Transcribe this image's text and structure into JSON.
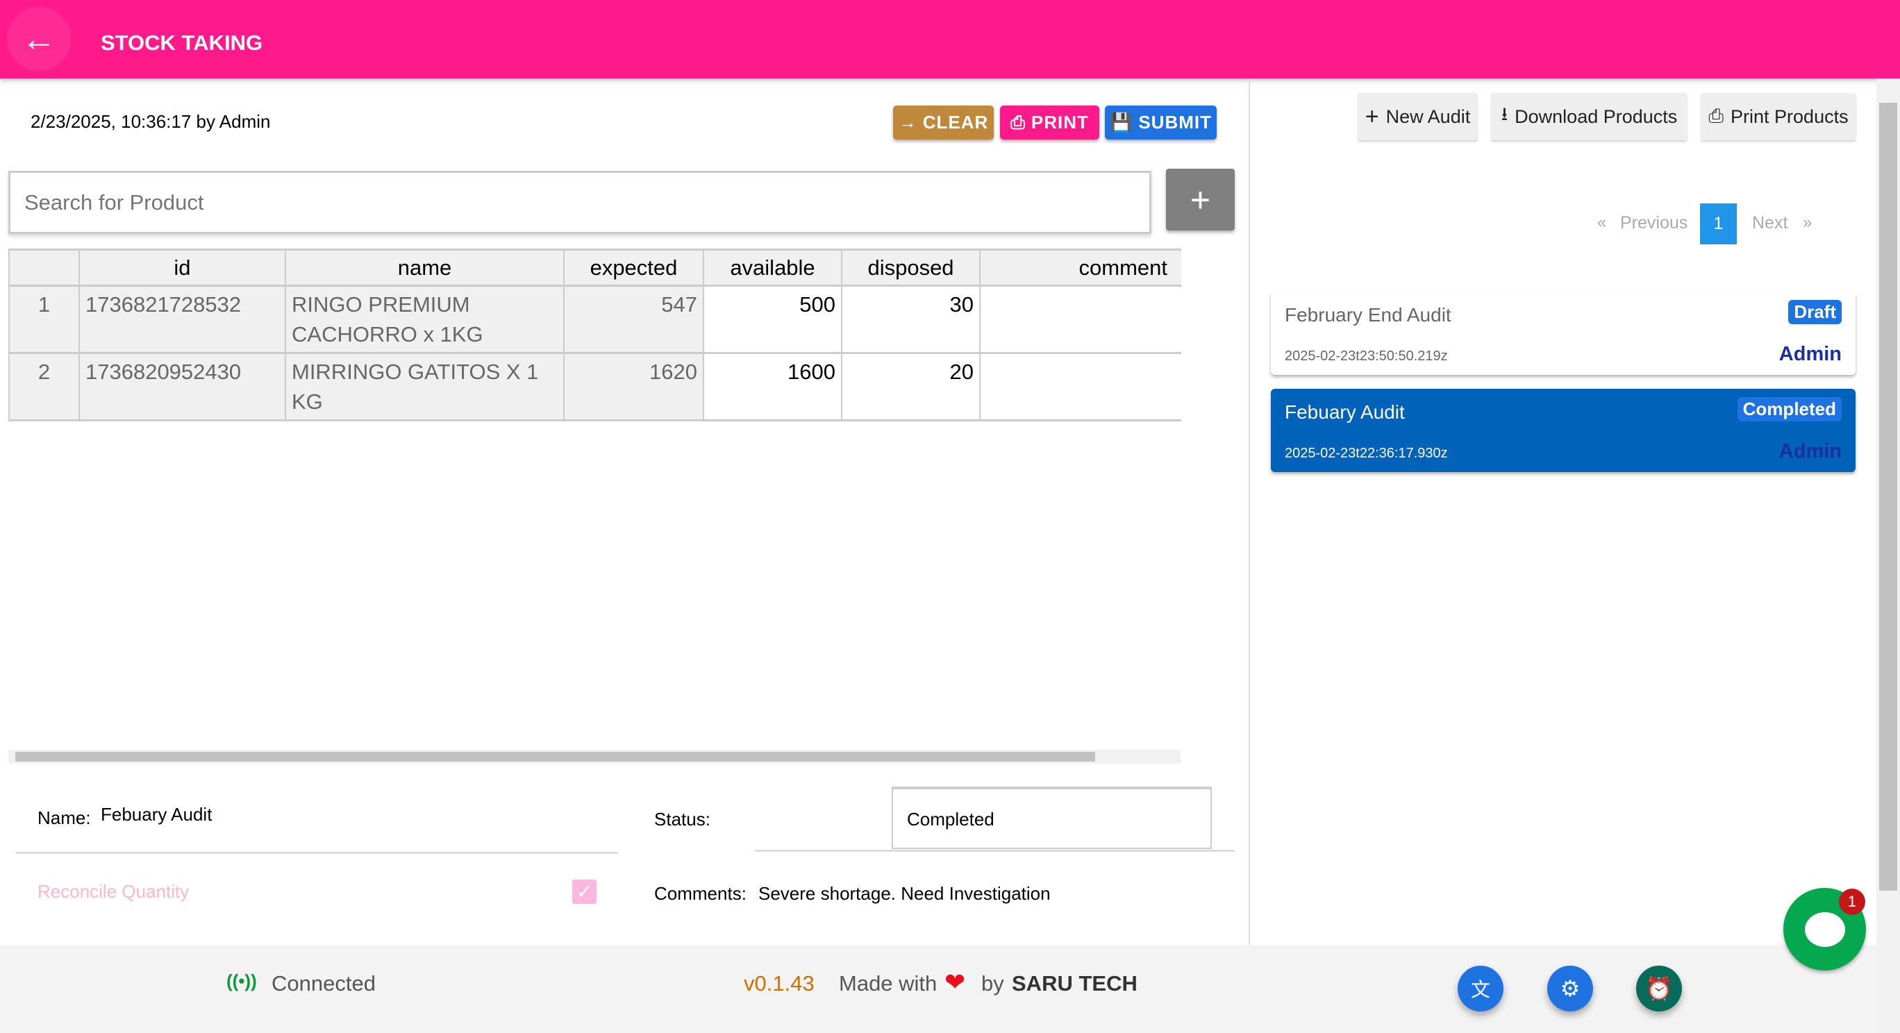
{
  "header": {
    "title": "STOCK TAKING",
    "back_icon": "arrow-left-icon",
    "color": "#ff1a8c"
  },
  "toolbar": {
    "datetime": "2/23/2025, 10:36:17 by Admin",
    "clear": "CLEAR",
    "print": "PRINT",
    "submit": "SUBMIT",
    "clear_color": "#c0883a",
    "print_color": "#ff1a8c",
    "submit_color": "#1e73e0"
  },
  "search": {
    "placeholder": "Search for Product",
    "add": "+"
  },
  "table": {
    "headers": [
      "",
      "id",
      "name",
      "expected",
      "available",
      "disposed",
      "comment"
    ],
    "rows": [
      [
        "1",
        "1736821728532",
        "RINGO PREMIUM CACHORRO x 1KG",
        "547",
        "500",
        "30",
        ""
      ],
      [
        "2",
        "1736820952430",
        "MIRRINGO GATITOS X 1 KG",
        "1620",
        "1600",
        "20",
        ""
      ]
    ]
  },
  "form": {
    "name_label": "Name:",
    "name_value": "Febuary Audit",
    "status_label": "Status:",
    "status_value": "Completed",
    "reconcile_label": "Reconcile Quantity",
    "reconcile_checked": true,
    "comments_label": "Comments:",
    "comments_value": "Severe shortage. Need Investigation"
  },
  "right": {
    "new_audit": "New Audit",
    "download": "Download Products",
    "print_products": "Print Products",
    "pagination": {
      "first": "«",
      "previous": "Previous",
      "current": "1",
      "next": "Next",
      "last": "»"
    },
    "audits": [
      {
        "title": "February End Audit",
        "status": "Draft",
        "date": "2025-02-23t23:50:50.219z",
        "user": "Admin"
      },
      {
        "title": "Febuary Audit",
        "status": "Completed",
        "date": "2025-02-23t22:36:17.930z",
        "user": "Admin",
        "selected": true
      }
    ]
  },
  "footer": {
    "connected": "Connected",
    "version": "v0.1.43",
    "made_with": "Made with",
    "by": "by",
    "brand": "SARU TECH",
    "chat_badge": "1"
  }
}
